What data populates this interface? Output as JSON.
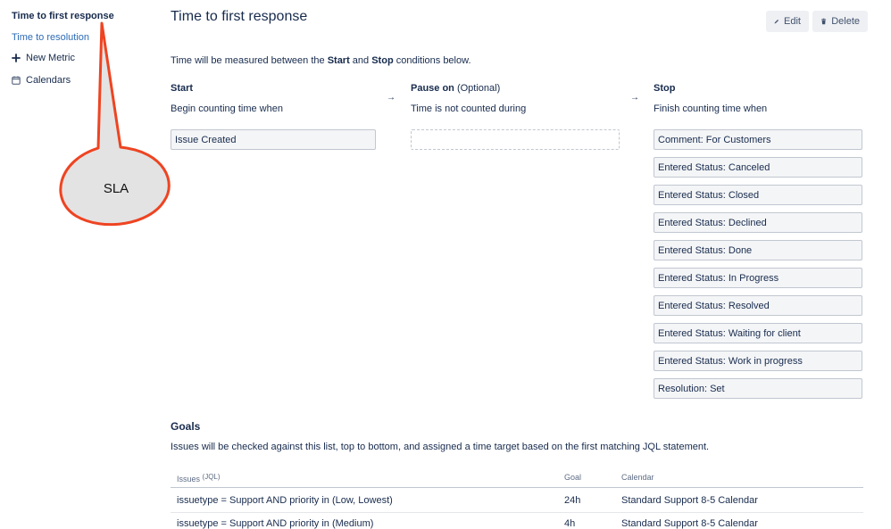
{
  "sidebar": {
    "active_item": "Time to first response",
    "items": [
      {
        "label": "Time to resolution",
        "icon": ""
      },
      {
        "label": "New Metric",
        "icon": "plus-icon"
      },
      {
        "label": "Calendars",
        "icon": "calendar-icon"
      }
    ]
  },
  "callout": {
    "label": "SLA",
    "colors": {
      "border": "#ee4422",
      "fill": "#e3e3e3"
    }
  },
  "header": {
    "title": "Time to first response",
    "edit_label": "Edit",
    "delete_label": "Delete"
  },
  "intro": {
    "prefix": "Time will be measured between the ",
    "start_word": "Start",
    "middle": " and ",
    "stop_word": "Stop",
    "suffix": " conditions below."
  },
  "columns": {
    "start": {
      "title": "Start",
      "subtitle": "Begin counting time when",
      "conditions": [
        "Issue Created"
      ]
    },
    "pause": {
      "title": "Pause on",
      "title_suffix": " (Optional)",
      "subtitle": "Time is not counted during",
      "conditions": []
    },
    "stop": {
      "title": "Stop",
      "subtitle": "Finish counting time when",
      "conditions": [
        "Comment: For Customers",
        "Entered Status: Canceled",
        "Entered Status: Closed",
        "Entered Status: Declined",
        "Entered Status: Done",
        "Entered Status: In Progress",
        "Entered Status: Resolved",
        "Entered Status: Waiting for client",
        "Entered Status: Work in progress",
        "Resolution: Set"
      ]
    },
    "arrow_glyph": "→"
  },
  "goals": {
    "title": "Goals",
    "description": "Issues will be checked against this list, top to bottom, and assigned a time target based on the first matching JQL statement.",
    "headers": {
      "issues": "Issues",
      "issues_sup": "(JQL)",
      "goal": "Goal",
      "calendar": "Calendar"
    },
    "rows": [
      {
        "jql": "issuetype = Support AND priority in (Low, Lowest)",
        "goal": "24h",
        "calendar": "Standard Support 8-5 Calendar"
      },
      {
        "jql": "issuetype = Support AND priority in (Medium)",
        "goal": "4h",
        "calendar": "Standard Support 8-5 Calendar"
      }
    ]
  }
}
